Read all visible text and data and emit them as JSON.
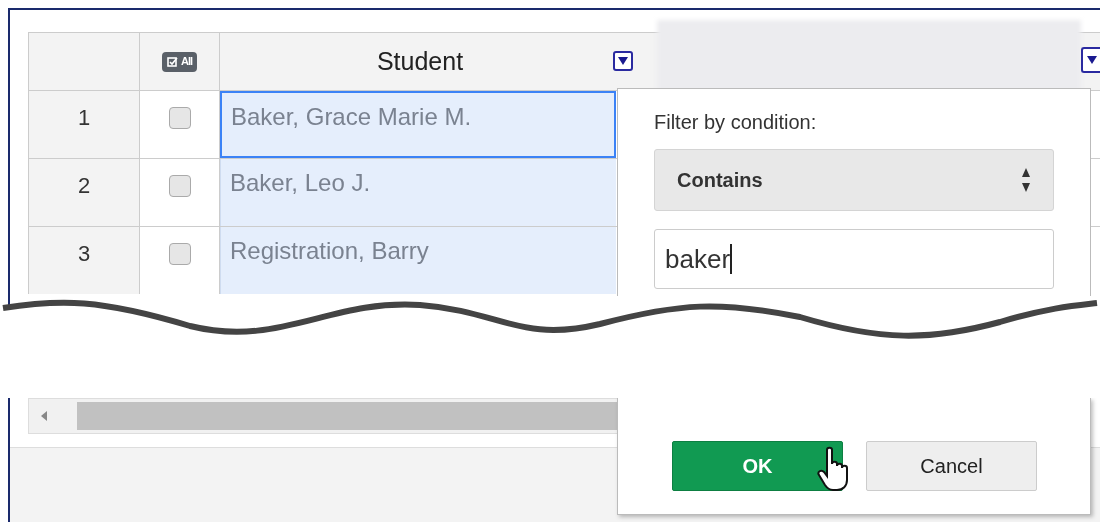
{
  "grid": {
    "select_all_label": "All",
    "column_header": "Student",
    "rows": [
      {
        "number": "1",
        "checked": false,
        "name": "Baker, Grace Marie M.",
        "selected": true
      },
      {
        "number": "2",
        "checked": false,
        "name": "Baker, Leo J.",
        "selected": false
      },
      {
        "number": "3",
        "checked": false,
        "name": "Registration, Barry",
        "selected": false
      }
    ]
  },
  "filter_popup": {
    "label": "Filter by condition:",
    "condition": "Contains",
    "value": "baker",
    "buttons": [
      {
        "label": "OK",
        "kind": "primary"
      },
      {
        "label": "Cancel",
        "kind": "secondary"
      }
    ]
  }
}
